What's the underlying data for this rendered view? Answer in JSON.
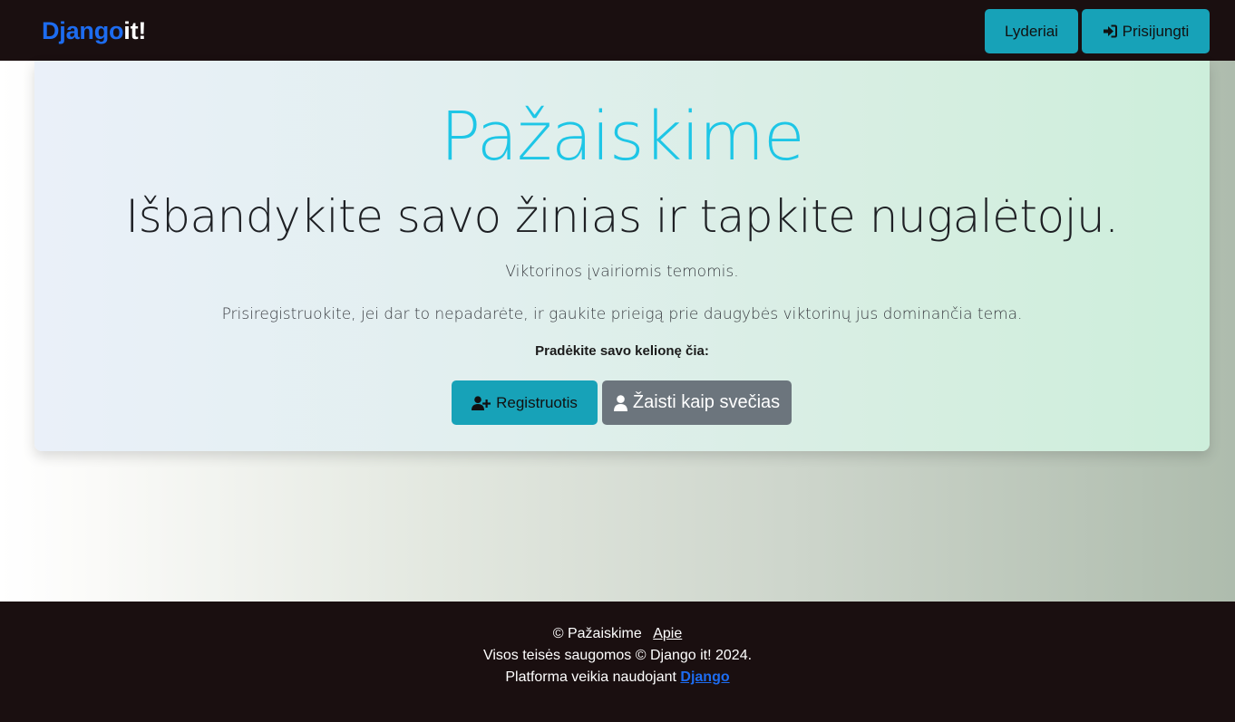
{
  "navbar": {
    "brand_part1": "Django",
    "brand_part2": "it!",
    "leaders_label": "Lyderiai",
    "login_label": "Prisijungti",
    "login_icon": "sign-in-icon"
  },
  "hero": {
    "title": "Pažaiskime",
    "subtitle": "Išbandykite savo žinias ir tapkite nugalėtoju.",
    "text1": "Viktorinos įvairiomis temomis.",
    "text2": "Prisiregistruokite, jei dar to nepadarėte, ir gaukite prieigą prie daugybės viktorinų jus dominančia tema.",
    "cta": "Pradėkite savo kelionę čia:",
    "register_label": "Registruotis",
    "register_icon": "user-plus-icon",
    "guest_label": "Žaisti kaip svečias",
    "guest_icon": "user-icon"
  },
  "footer": {
    "copyright": "© Pažaiskime",
    "about_link": "Apie",
    "rights": "Visos teisės saugomos © Django it! 2024.",
    "powered_by": "Platforma veikia naudojant",
    "django_link": "Django"
  },
  "colors": {
    "navbar_bg": "#1a0f10",
    "brand_blue": "#1d6cf0",
    "accent_teal": "#17a2b8",
    "title_cyan": "#1ec6e6",
    "secondary_gray": "#6c757d"
  }
}
